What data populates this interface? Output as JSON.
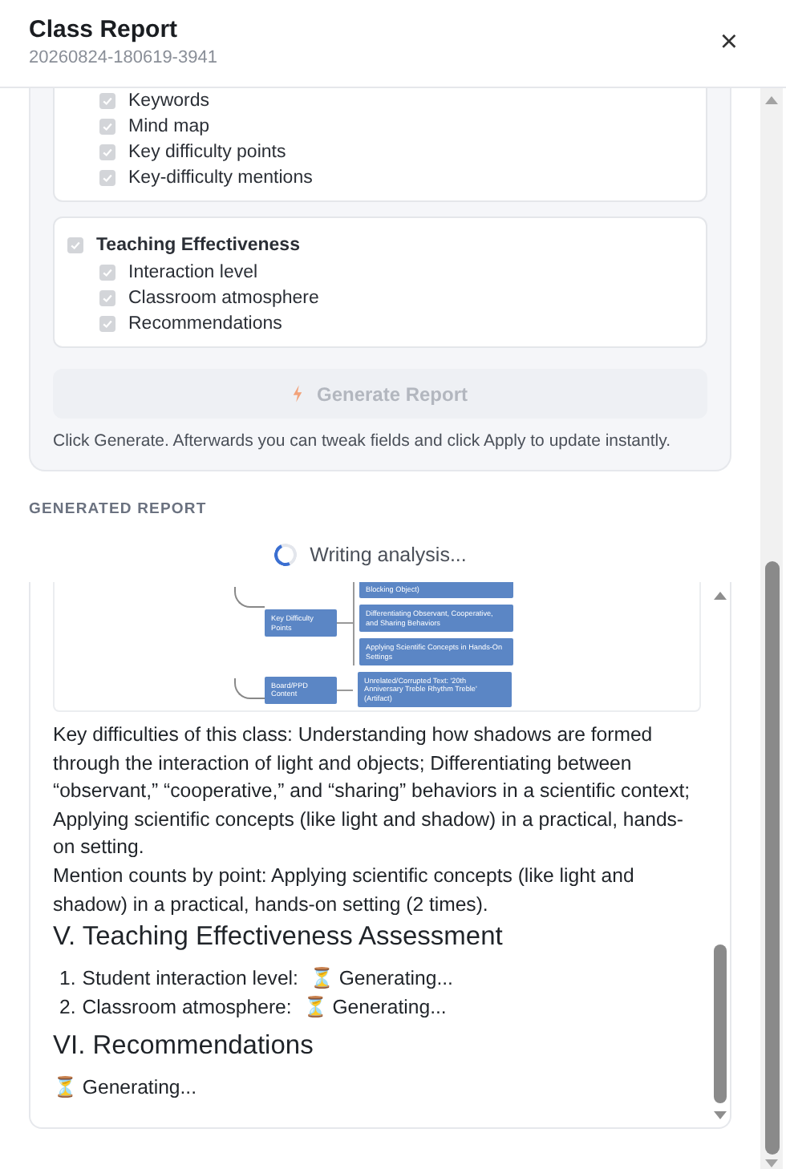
{
  "header": {
    "title": "Class Report",
    "subtitle": "20260824-180619-3941",
    "close": "×"
  },
  "settings": {
    "groups": [
      {
        "items": [
          {
            "label": "Keywords",
            "checked": true
          },
          {
            "label": "Mind map",
            "checked": true
          },
          {
            "label": "Key difficulty points",
            "checked": true
          },
          {
            "label": "Key-difficulty mentions",
            "checked": true
          }
        ]
      },
      {
        "label": "Teaching Effectiveness",
        "checked": true,
        "items": [
          {
            "label": "Interaction level",
            "checked": true
          },
          {
            "label": "Classroom atmosphere",
            "checked": true
          },
          {
            "label": "Recommendations",
            "checked": true
          }
        ]
      }
    ],
    "generate_button": {
      "label": "Generate Report",
      "disabled": true
    },
    "hint": "Click Generate. Afterwards you can tweak fields and click Apply to update instantly."
  },
  "report": {
    "section_label": "GENERATED REPORT",
    "status": "Writing analysis...",
    "mind_map": {
      "branches": [
        {
          "label": "Key Difficulty Points",
          "children": [
            "Blocking Object)",
            "Differentiating Observant, Cooperative, and Sharing Behaviors",
            "Applying Scientific Concepts in Hands-On Settings"
          ]
        },
        {
          "label": "Board/PPD Content",
          "children": [
            "Unrelated/Corrupted Text: '20th Anniversary Treble Rhythm Treble' (Artifact)"
          ]
        }
      ]
    },
    "blocks": [
      {
        "kind": "paragraph",
        "text": "Key difficulties of this class: Understanding how shadows are formed through the interaction of light and objects; Differentiating between “observant,” “cooperative,” and “sharing” behaviors in a scientific context; Applying scientific concepts (like light and shadow) in a practical, hands-on setting."
      },
      {
        "kind": "paragraph",
        "text": "Mention counts by point: Applying scientific concepts (like light and shadow) in a practical, hands-on setting (2 times)."
      },
      {
        "kind": "heading",
        "text": "V. Teaching Effectiveness Assessment"
      },
      {
        "kind": "list",
        "items": [
          {
            "number": "1.",
            "label": "Student interaction level:",
            "status": "⏳ Generating..."
          },
          {
            "number": "2.",
            "label": "Classroom atmosphere:",
            "status": "⏳ Generating..."
          }
        ]
      },
      {
        "kind": "heading",
        "text": "VI. Recommendations"
      },
      {
        "kind": "status",
        "text": "⏳ Generating..."
      }
    ]
  }
}
